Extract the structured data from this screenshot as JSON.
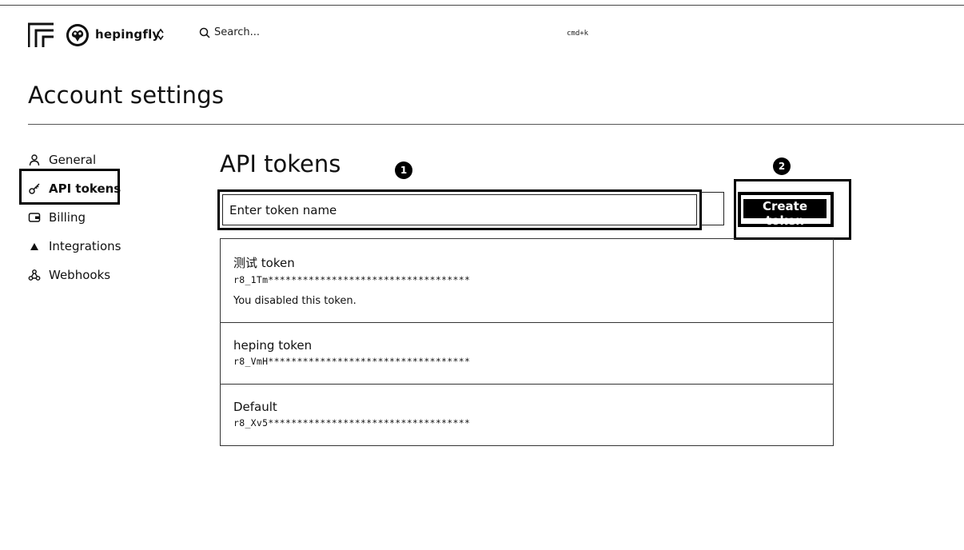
{
  "header": {
    "username": "hepingfly",
    "search_placeholder": "Search...",
    "search_shortcut": "cmd+k"
  },
  "page": {
    "title": "Account settings"
  },
  "sidebar": {
    "items": [
      {
        "label": "General",
        "icon": "user-icon",
        "active": false
      },
      {
        "label": "API tokens",
        "icon": "key-icon",
        "active": true
      },
      {
        "label": "Billing",
        "icon": "wallet-icon",
        "active": false
      },
      {
        "label": "Integrations",
        "icon": "triangle-icon",
        "active": false
      },
      {
        "label": "Webhooks",
        "icon": "webhook-icon",
        "active": false
      }
    ]
  },
  "main": {
    "title": "API tokens",
    "token_input_placeholder": "Enter token name",
    "create_button_label": "Create token",
    "step_markers": [
      "1",
      "2"
    ],
    "tokens": [
      {
        "name": "测试 token",
        "key": "r8_1Tm***********************************",
        "status": "You disabled this token."
      },
      {
        "name": "heping token",
        "key": "r8_VmH***********************************",
        "status": ""
      },
      {
        "name": "Default",
        "key": "r8_Xv5***********************************",
        "status": ""
      }
    ]
  }
}
